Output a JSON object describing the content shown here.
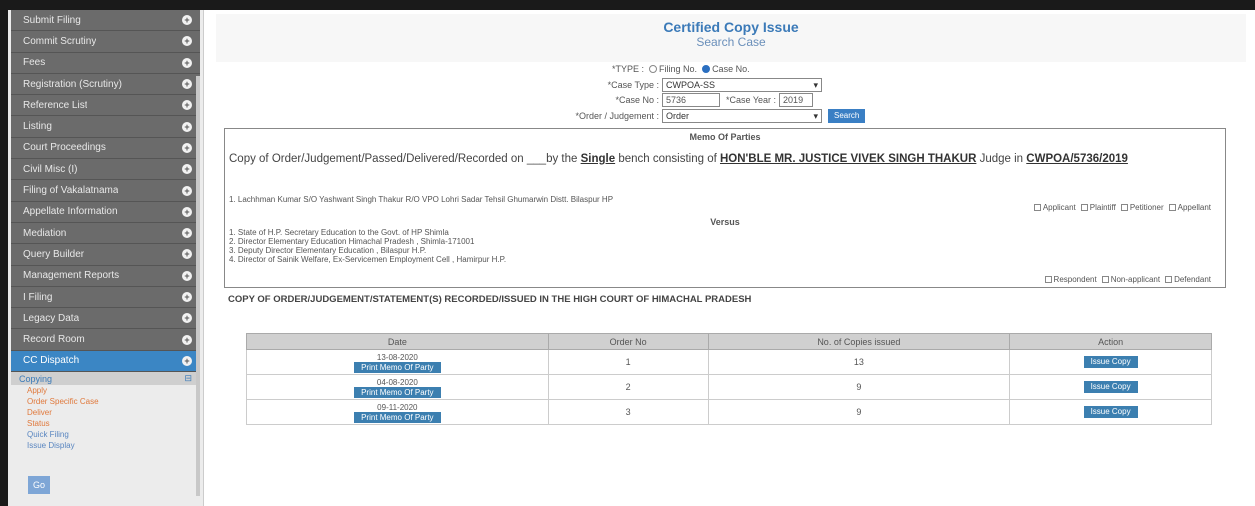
{
  "sidebar": {
    "items": [
      {
        "label": "Submit Filing"
      },
      {
        "label": "Commit Scrutiny"
      },
      {
        "label": "Fees"
      },
      {
        "label": "Registration (Scrutiny)"
      },
      {
        "label": "Reference List"
      },
      {
        "label": "Listing"
      },
      {
        "label": "Court Proceedings"
      },
      {
        "label": "Civil Misc (I)"
      },
      {
        "label": "Filing of Vakalatnama"
      },
      {
        "label": "Appellate Information"
      },
      {
        "label": "Mediation"
      },
      {
        "label": "Query Builder"
      },
      {
        "label": "Management Reports"
      },
      {
        "label": "I Filing"
      },
      {
        "label": "Legacy Data"
      },
      {
        "label": "Record Room"
      },
      {
        "label": "CC Dispatch"
      }
    ],
    "submenu_title": "Copying",
    "submenu_links": [
      "Apply",
      "Order Specific Case",
      "Deliver",
      "Status",
      "Quick Filing",
      "Issue Display"
    ],
    "bottom_button": "Go"
  },
  "header": {
    "title": "Certified Copy Issue",
    "subtitle": "Search Case"
  },
  "form": {
    "type_label": "TYPE",
    "radio_filing": "Filing No.",
    "radio_case": "Case No.",
    "case_type_label": "*Case Type :",
    "case_type_value": "CWPOA-SS",
    "case_no_label": "*Case No :",
    "case_no_value": "5736",
    "case_year_label": "*Case Year :",
    "case_year_value": "2019",
    "order_label": "*Order / Judgement :",
    "order_value": "Order",
    "search_button": "Search"
  },
  "memo": {
    "title": "Memo Of Parties",
    "line_prefix": "Copy of Order/Judgement/Passed/Delivered/Recorded on ___by the",
    "bench": "Single",
    "line_mid": "bench consisting of",
    "judge": "HON'BLE MR. JUSTICE VIVEK SINGH THAKUR",
    "line_suffix": "Judge in",
    "case_ref": "CWPOA/5736/2019",
    "petitioners": [
      "1. Lachhman Kumar S/O Yashwant Singh Thakur R/O VPO Lohri Sadar Tehsil Ghumarwin Distt. Bilaspur HP"
    ],
    "petitioner_options": [
      "Applicant",
      "Plaintiff",
      "Petitioner",
      "Appellant"
    ],
    "versus": "Versus",
    "respondents": [
      "1.  State of H.P. Secretary Education to the Govt. of HP Shimla",
      "2.  Director Elementary Education Himachal Pradesh , Shimla-171001",
      "3.  Deputy Director Elementary Education , Bilaspur H.P.",
      "4.  Director of Sainik Welfare, Ex-Servicemen Employment Cell , Hamirpur H.P."
    ],
    "respondent_options": [
      "Respondent",
      "Non-applicant",
      "Defendant"
    ],
    "footer": "COPY OF ORDER/JUDGEMENT/STATEMENT(S) RECORDED/ISSUED IN THE HIGH COURT OF HIMACHAL PRADESH"
  },
  "table": {
    "headers": [
      "Date",
      "Order No",
      "No. of Copies issued",
      "Action"
    ],
    "rows": [
      {
        "date": "13-08-2020",
        "date_button": "Print Memo Of Party",
        "order_no": "1",
        "copies": "13",
        "action": "Issue Copy"
      },
      {
        "date": "04-08-2020",
        "date_button": "Print Memo Of Party",
        "order_no": "2",
        "copies": "9",
        "action": "Issue Copy"
      },
      {
        "date": "09-11-2020",
        "date_button": "Print Memo Of Party",
        "order_no": "3",
        "copies": "9",
        "action": "Issue Copy"
      }
    ]
  }
}
